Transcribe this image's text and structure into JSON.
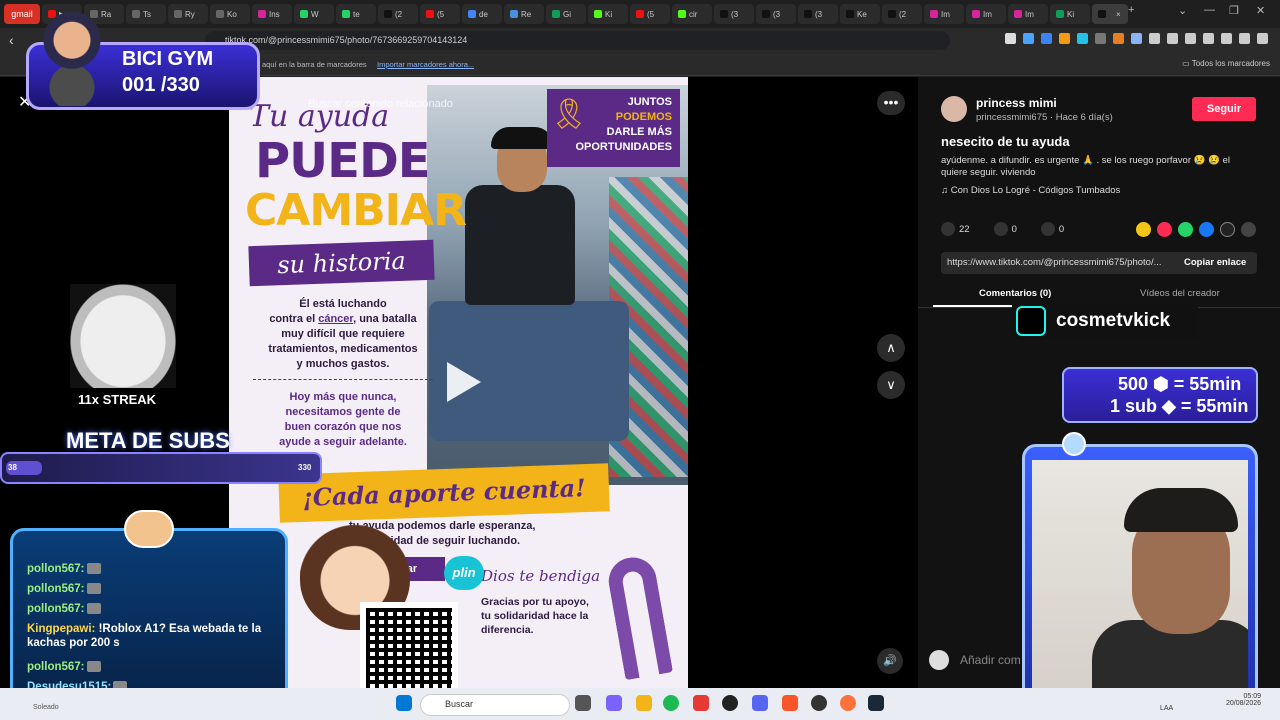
{
  "browser": {
    "tabs": [
      {
        "label": "gmail",
        "kind": "gmail"
      },
      {
        "label": "▶",
        "color": "#e11"
      },
      {
        "label": "Ra",
        "color": "#666"
      },
      {
        "label": "Ts",
        "color": "#666"
      },
      {
        "label": "Ry",
        "color": "#666"
      },
      {
        "label": "Ko",
        "color": "#666"
      },
      {
        "label": "Ins",
        "color": "#d6249f"
      },
      {
        "label": "W",
        "color": "#25d366"
      },
      {
        "label": "te",
        "color": "#25d366"
      },
      {
        "label": "(2",
        "color": "#111"
      },
      {
        "label": "(5",
        "color": "#e11"
      },
      {
        "label": "de",
        "color": "#4285f4"
      },
      {
        "label": "Re",
        "color": "#4a90e2"
      },
      {
        "label": "Gi",
        "color": "#0f9d58"
      },
      {
        "label": "Ki",
        "color": "#53fc18"
      },
      {
        "label": "(5",
        "color": "#e11"
      },
      {
        "label": "cir",
        "color": "#53fc18"
      },
      {
        "label": "(3",
        "color": "#111"
      },
      {
        "label": "(3",
        "color": "#111"
      },
      {
        "label": "(3",
        "color": "#111"
      },
      {
        "label": "Ke",
        "color": "#111"
      },
      {
        "label": "(2",
        "color": "#111"
      },
      {
        "label": "Im",
        "color": "#d6249f"
      },
      {
        "label": "Im",
        "color": "#d6249f"
      },
      {
        "label": "Im",
        "color": "#d6249f"
      },
      {
        "label": "Ki",
        "color": "#0f9d58"
      },
      {
        "label": "",
        "color": "#111",
        "kind": "active"
      }
    ],
    "url": "tiktok.com/@princessmimi675/photo/7673669259704143124",
    "bookmark_prompt": "aquí en la barra de marcadores",
    "bookmark_import": "Importar marcadores ahora...",
    "all_bookmarks": "Todos los marcadores",
    "close_tab": "×",
    "new_tab": "+"
  },
  "viewer": {
    "search_placeholder": "Buscar contenido relacionado",
    "close": "✕",
    "more": "•••",
    "up": "∧",
    "down": "∨",
    "volume": "🔊"
  },
  "poster": {
    "tu_ayuda": "Tu ayuda",
    "puede": "PUEDE",
    "cambiar": "CAMBIAR",
    "su_historia": "su historia",
    "luchando_1": "Él está luchando",
    "luchando_2a": "contra el ",
    "luchando_cancer": "cáncer",
    "luchando_2b": ", una batalla",
    "luchando_3": "muy difícil que requiere",
    "luchando_4": "tratamientos, medicamentos",
    "luchando_5": "y muchos gastos.",
    "hoy_1": "Hoy más que nunca,",
    "hoy_2": "necesitamos gente de",
    "hoy_3": "buen corazón que nos",
    "hoy_4": "ayude a seguir adelante.",
    "juntos_1": "JUNTOS",
    "juntos_2": "PODEMOS",
    "juntos_3": "DARLE MÁS",
    "juntos_4": "OPORTUNIDADES",
    "cada": "¡Cada aporte cuenta!",
    "esperanza_1": "tu ayuda podemos darle esperanza,",
    "esperanza_2": "oportunidad de seguir luchando.",
    "colaborar": "borar",
    "dios": "Dios te bendiga",
    "gracias": "Gracias por tu apoyo, tu solidaridad hace la diferencia."
  },
  "panel": {
    "creator_name": "princess mimi",
    "handle": "princessmimi675 · Hace 6 día(s)",
    "follow": "Seguir",
    "title": "nesecito de tu ayuda",
    "description": "ayúdenme. a difundir. es urgente 🙏 . se los ruego porfavor 😢 😢 el quiere seguir. viviendo",
    "music": "♫  Con Dios Lo Logré - Códigos Tumbados",
    "likes": "22",
    "comments": "0",
    "saves": "0",
    "link": "https://www.tiktok.com/@princessmimi675/photo/...",
    "copy_link": "Copiar enlace",
    "tab_comments": "Comentarios (0)",
    "tab_videos": "Vídeos del creador",
    "add_comment": "Añadir com"
  },
  "overlay": {
    "bici_title": "BICI GYM",
    "bici_count": "001 /330",
    "streak": "11x STREAK",
    "meta": "META DE SUBS",
    "meta_current": "38",
    "meta_goal": "330",
    "meta_progress": 0.115,
    "kick_name": "cosmetvkick",
    "sub_line1": "500 ⬢ = 55min",
    "sub_line2": "1 sub ◆ = 55min",
    "plin": "plin",
    "chat": [
      {
        "user": "pollon567:",
        "msg": "",
        "emote": true,
        "style": "green"
      },
      {
        "user": "pollon567:",
        "msg": "",
        "emote": true,
        "style": "green"
      },
      {
        "user": "pollon567:",
        "msg": "",
        "emote": true,
        "style": "green"
      },
      {
        "user": "Kingpepawi:",
        "msg": " !Roblox A1? Esa webada te la kachas por 200 s",
        "emote": false,
        "style": "pink"
      },
      {
        "user": "pollon567:",
        "msg": "",
        "emote": true,
        "style": "green"
      },
      {
        "user": "Desudesu1515:",
        "msg": "",
        "emote": true,
        "style": "blue"
      }
    ]
  },
  "taskbar": {
    "search": "Buscar",
    "lang": "LAA",
    "time": "05:09",
    "date": "20/08/2026",
    "left_label": "Soleado"
  }
}
